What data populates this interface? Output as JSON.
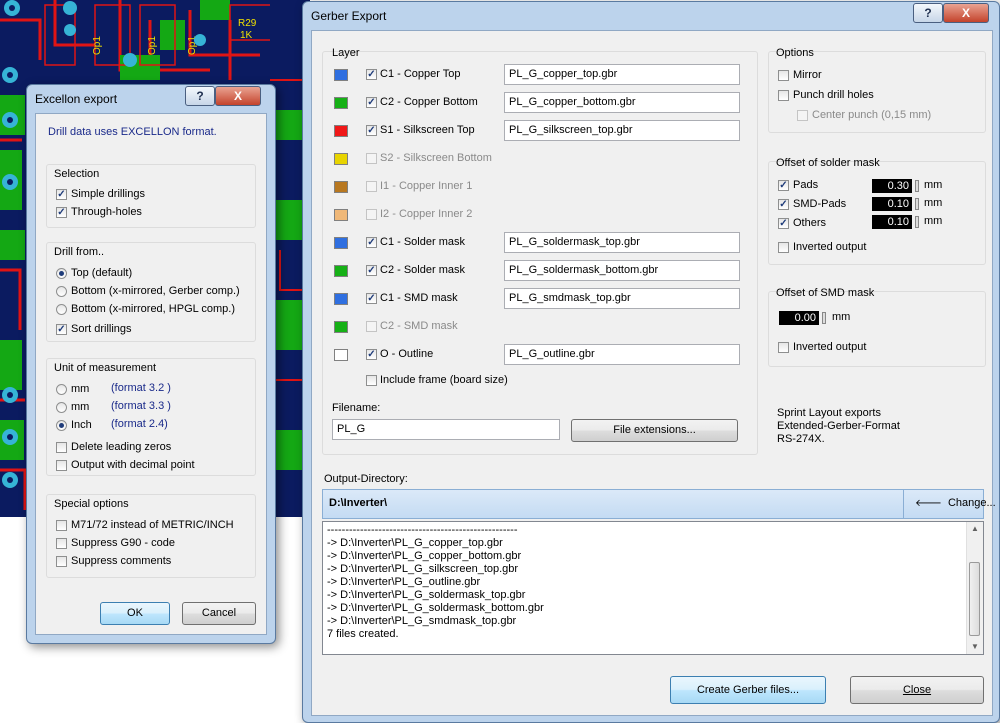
{
  "excellon": {
    "title": "Excellon export",
    "help_btn": "?",
    "close_btn": "X",
    "info": "Drill data uses EXCELLON format.",
    "selection": {
      "label": "Selection",
      "items": [
        {
          "label": "Simple drillings",
          "checked": true
        },
        {
          "label": "Through-holes",
          "checked": true
        }
      ]
    },
    "drill_from": {
      "label": "Drill from..",
      "options": [
        {
          "label": "Top (default)",
          "selected": true
        },
        {
          "label": "Bottom (x-mirrored, Gerber comp.)",
          "selected": false
        },
        {
          "label": "Bottom (x-mirrored, HPGL comp.)",
          "selected": false
        }
      ],
      "sort": {
        "label": "Sort drillings",
        "checked": true
      }
    },
    "unit": {
      "label": "Unit of measurement",
      "options": [
        {
          "label": "mm",
          "format": "(format 3.2 )",
          "selected": false
        },
        {
          "label": "mm",
          "format": "(format 3.3 )",
          "selected": false
        },
        {
          "label": "Inch",
          "format": "(format 2.4)",
          "selected": true
        }
      ],
      "delete_zeros": {
        "label": "Delete leading zeros",
        "checked": false
      },
      "decimal_point": {
        "label": "Output with decimal point",
        "checked": false
      }
    },
    "special": {
      "label": "Special options",
      "items": [
        {
          "label": "M71/72 instead of METRIC/INCH",
          "checked": false
        },
        {
          "label": "Suppress G90 - code",
          "checked": false
        },
        {
          "label": "Suppress comments",
          "checked": false
        }
      ]
    },
    "ok": "OK",
    "cancel": "Cancel"
  },
  "gerber": {
    "title": "Gerber Export",
    "help_btn": "?",
    "close_btn": "X",
    "layer_label": "Layer",
    "layers": [
      {
        "color": "#2f6fe0",
        "label": "C1 - Copper Top",
        "checked": true,
        "enabled": true,
        "file": "PL_G_copper_top.gbr"
      },
      {
        "color": "#16b016",
        "label": "C2 - Copper Bottom",
        "checked": true,
        "enabled": true,
        "file": "PL_G_copper_bottom.gbr"
      },
      {
        "color": "#f01818",
        "label": "S1 - Silkscreen Top",
        "checked": true,
        "enabled": true,
        "file": "PL_G_silkscreen_top.gbr"
      },
      {
        "color": "#e8d400",
        "label": "S2 - Silkscreen Bottom",
        "checked": false,
        "enabled": false,
        "file": ""
      },
      {
        "color": "#b87820",
        "label": "I1 - Copper Inner 1",
        "checked": false,
        "enabled": false,
        "file": ""
      },
      {
        "color": "#f0b878",
        "label": "I2 - Copper Inner 2",
        "checked": false,
        "enabled": false,
        "file": ""
      },
      {
        "color": "#2f6fe0",
        "label": "C1 - Solder mask",
        "checked": true,
        "enabled": true,
        "file": "PL_G_soldermask_top.gbr"
      },
      {
        "color": "#16b016",
        "label": "C2 - Solder mask",
        "checked": true,
        "enabled": true,
        "file": "PL_G_soldermask_bottom.gbr"
      },
      {
        "color": "#2f6fe0",
        "label": "C1 - SMD mask",
        "checked": true,
        "enabled": true,
        "file": "PL_G_smdmask_top.gbr"
      },
      {
        "color": "#16b016",
        "label": "C2 - SMD mask",
        "checked": false,
        "enabled": false,
        "file": ""
      },
      {
        "color": "#ffffff",
        "label": "O - Outline",
        "checked": true,
        "enabled": true,
        "file": "PL_G_outline.gbr"
      }
    ],
    "include_frame": {
      "label": "Include frame (board size)",
      "checked": false
    },
    "filename_label": "Filename:",
    "filename": "PL_G",
    "file_ext_btn": "File extensions...",
    "options": {
      "label": "Options",
      "mirror": {
        "label": "Mirror",
        "checked": false
      },
      "punch": {
        "label": "Punch drill holes",
        "checked": false
      },
      "center": {
        "label": "Center punch (0,15 mm)",
        "checked": false
      }
    },
    "solder_offset": {
      "label": "Offset of solder mask",
      "rows": [
        {
          "label": "Pads",
          "checked": true,
          "value": "0.30",
          "unit": "mm"
        },
        {
          "label": "SMD-Pads",
          "checked": true,
          "value": "0.10",
          "unit": "mm"
        },
        {
          "label": "Others",
          "checked": true,
          "value": "0.10",
          "unit": "mm"
        }
      ],
      "inverted": {
        "label": "Inverted output",
        "checked": false
      }
    },
    "smd_offset": {
      "label": "Offset of SMD mask",
      "value": "0.00",
      "unit": "mm",
      "inverted": {
        "label": "Inverted output",
        "checked": false
      }
    },
    "info": [
      "Sprint Layout exports",
      "Extended-Gerber-Format",
      "RS-274X."
    ],
    "output_dir_label": "Output-Directory:",
    "output_dir": "D:\\Inverter\\",
    "change_btn": "Change...",
    "log": [
      "----------------------------------------------------",
      "-> D:\\Inverter\\PL_G_copper_top.gbr",
      "-> D:\\Inverter\\PL_G_copper_bottom.gbr",
      "-> D:\\Inverter\\PL_G_silkscreen_top.gbr",
      "-> D:\\Inverter\\PL_G_outline.gbr",
      "-> D:\\Inverter\\PL_G_soldermask_top.gbr",
      "-> D:\\Inverter\\PL_G_soldermask_bottom.gbr",
      "-> D:\\Inverter\\PL_G_smdmask_top.gbr",
      "7 files created."
    ],
    "create_btn": "Create Gerber files...",
    "close_label": "Close"
  },
  "pcb": {
    "labels": [
      "Op1",
      "Op1",
      "Op1",
      "R29",
      "1K"
    ]
  }
}
